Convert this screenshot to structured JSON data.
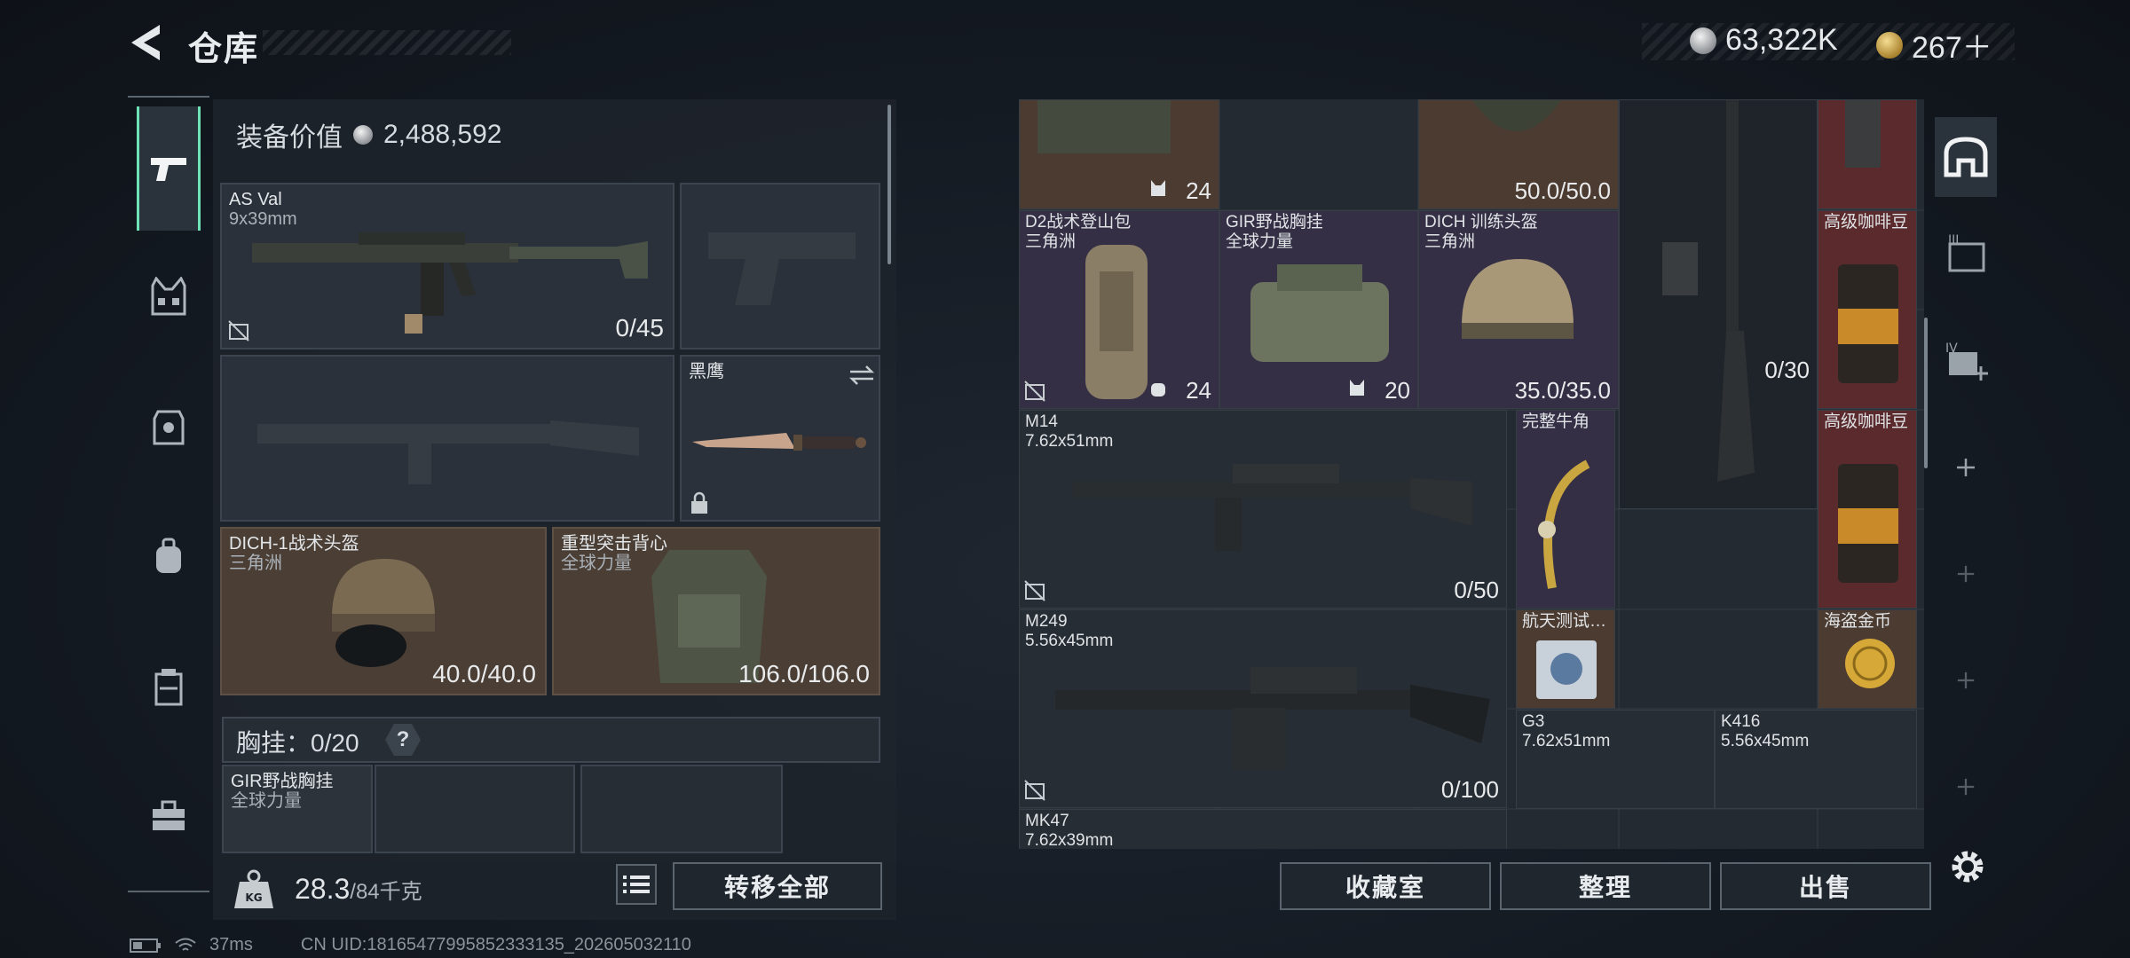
{
  "header": {
    "title": "仓库",
    "silver": "63,322K",
    "gold": "267＋"
  },
  "equip": {
    "label": "装备价值",
    "value": "2,488,592"
  },
  "slots": {
    "primary": {
      "name": "AS Val",
      "caliber": "9x39mm",
      "ammo": "0/45"
    },
    "melee": {
      "name": "黑鹰"
    },
    "helmet": {
      "name": "DICH-1战术头盔",
      "faction": "三角洲",
      "durability": "40.0/40.0"
    },
    "armor": {
      "name": "重型突击背心",
      "faction": "全球力量",
      "durability": "106.0/106.0"
    }
  },
  "chest": {
    "label": "胸挂：",
    "capacity": "0/20",
    "help": "?",
    "item_name": "GIR野战胸挂",
    "item_faction": "全球力量"
  },
  "weight": {
    "value": "28.3",
    "max": "/84千克",
    "lock_label": "KG"
  },
  "buttons": {
    "transfer_all": "转移全部",
    "collection": "收藏室",
    "sort": "整理",
    "sell": "出售"
  },
  "stash": {
    "row0": {
      "c0_count": "24",
      "c2_count": "50.0/50.0"
    },
    "d2": {
      "name": "D2战术登山包",
      "faction": "三角洲",
      "count": "24"
    },
    "gir": {
      "name": "GIR野战胸挂",
      "faction": "全球力量",
      "count": "20"
    },
    "dich": {
      "name": "DICH 训练头盔",
      "faction": "三角洲",
      "count": "35.0/35.0"
    },
    "rifle_right": {
      "count": "0/30"
    },
    "coffee1": {
      "name": "高级咖啡豆"
    },
    "m14": {
      "name": "M14",
      "caliber": "7.62x51mm",
      "count": "0/50"
    },
    "horn": {
      "name": "完整牛角"
    },
    "coffee2": {
      "name": "高级咖啡豆"
    },
    "m249": {
      "name": "M249",
      "caliber": "5.56x45mm",
      "count": "0/100"
    },
    "hdd": {
      "name": "航天测试…"
    },
    "coin": {
      "name": "海盗金币"
    },
    "g3": {
      "name": "G3",
      "caliber": "7.62x51mm"
    },
    "k416": {
      "name": "K416",
      "caliber": "5.56x45mm"
    },
    "mk47": {
      "name": "MK47",
      "caliber": "7.62x39mm"
    }
  },
  "status": {
    "ping": "37ms",
    "uid": "CN UID:18165477995852333135_202605032110"
  },
  "colors": {
    "accent": "#6fe3b8",
    "brown_slot": "#4a3e35",
    "purple_slot": "#342f45",
    "red_slot": "#5a2a2c"
  }
}
